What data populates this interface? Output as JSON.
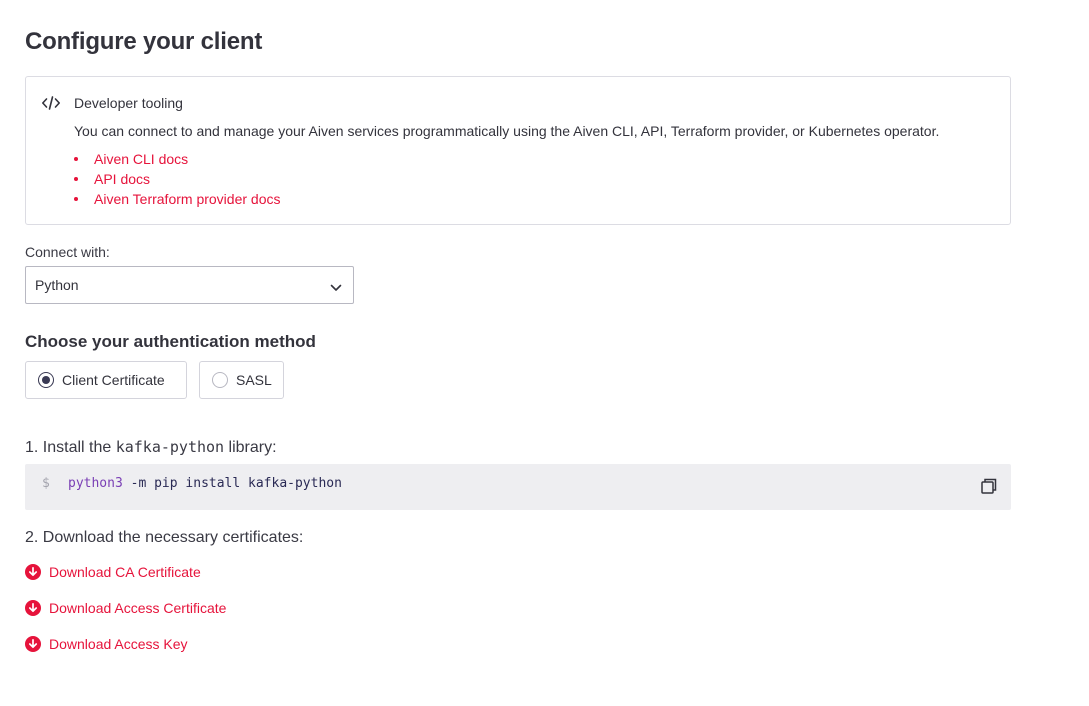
{
  "page": {
    "title": "Configure your client"
  },
  "developer_tooling": {
    "icon": "code-icon",
    "title": "Developer tooling",
    "description": "You can connect to and manage your Aiven services programmatically using the Aiven CLI, API, Terraform provider, or Kubernetes operator.",
    "links": [
      {
        "label": "Aiven CLI docs"
      },
      {
        "label": "API docs"
      },
      {
        "label": "Aiven Terraform provider docs"
      }
    ]
  },
  "connect": {
    "label": "Connect with:",
    "selected": "Python"
  },
  "auth": {
    "heading": "Choose your authentication method",
    "options": [
      {
        "label": "Client Certificate",
        "checked": true
      },
      {
        "label": "SASL",
        "checked": false
      }
    ]
  },
  "step1": {
    "prefix": "1. Install the ",
    "library": "kafka-python",
    "suffix": " library:",
    "prompt": "$",
    "command": "python3",
    "args": " -m pip install kafka-python"
  },
  "step2": {
    "label": "2. Download the necessary certificates:",
    "downloads": [
      {
        "label": "Download CA Certificate"
      },
      {
        "label": "Download Access Certificate"
      },
      {
        "label": "Download Access Key"
      }
    ]
  },
  "colors": {
    "accent": "#e6133b",
    "text": "#33333c",
    "code_bg": "#eeeef1",
    "command": "#7a3fb5"
  }
}
